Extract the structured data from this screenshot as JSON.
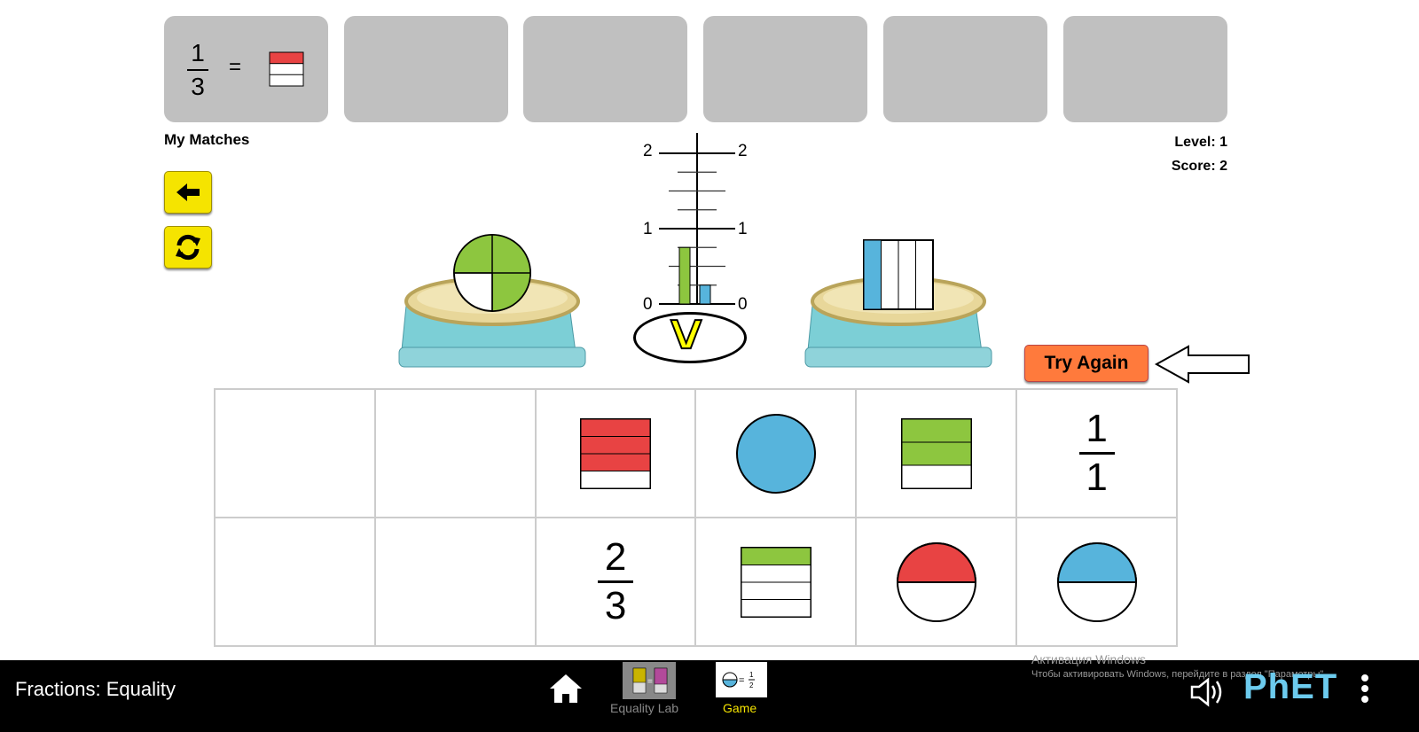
{
  "matches": [
    {
      "numerator": "1",
      "denominator": "3",
      "equals": "=",
      "shape": "rect-1of3-red"
    },
    {},
    {},
    {},
    {},
    {}
  ],
  "my_matches_label": "My Matches",
  "level": "Level: 1",
  "score": "Score: 2",
  "buttons": {
    "back_icon": "arrow-left-icon",
    "refresh_icon": "refresh-icon",
    "try_again": "Try Again"
  },
  "scale": {
    "tick_labels": [
      "0",
      "1",
      "2"
    ],
    "left_value": 0.75,
    "right_value": 0.25,
    "comparison": ">",
    "left_color": "#8dc63f",
    "right_color": "#57b4dc"
  },
  "left_item": "circle 3/4 green",
  "right_item": "rect 1/4 blue",
  "cards": [
    {
      "type": "empty"
    },
    {
      "type": "empty"
    },
    {
      "type": "rect",
      "parts": 4,
      "filled": 3,
      "color": "#e84343"
    },
    {
      "type": "circle",
      "parts": 1,
      "filled": 1,
      "color": "#57b4dc"
    },
    {
      "type": "rect",
      "parts": 3,
      "filled": 2,
      "color": "#8dc63f"
    },
    {
      "type": "fraction",
      "numerator": "1",
      "denominator": "1"
    },
    {
      "type": "empty"
    },
    {
      "type": "empty"
    },
    {
      "type": "fraction",
      "numerator": "2",
      "denominator": "3"
    },
    {
      "type": "rect",
      "parts": 4,
      "filled": 1,
      "color": "#8dc63f"
    },
    {
      "type": "circle",
      "parts": 2,
      "filled": 1,
      "color": "#e84343"
    },
    {
      "type": "circle",
      "parts": 2,
      "filled": 1,
      "color": "#57b4dc"
    }
  ],
  "navbar": {
    "title": "Fractions: Equality",
    "screens": [
      {
        "label": "Equality Lab"
      },
      {
        "label": "Game"
      }
    ],
    "brand": "PhET",
    "watermark_line1": "Активация Windows",
    "watermark_line2": "Чтобы активировать Windows, перейдите в раздел \"Параметры\"."
  }
}
